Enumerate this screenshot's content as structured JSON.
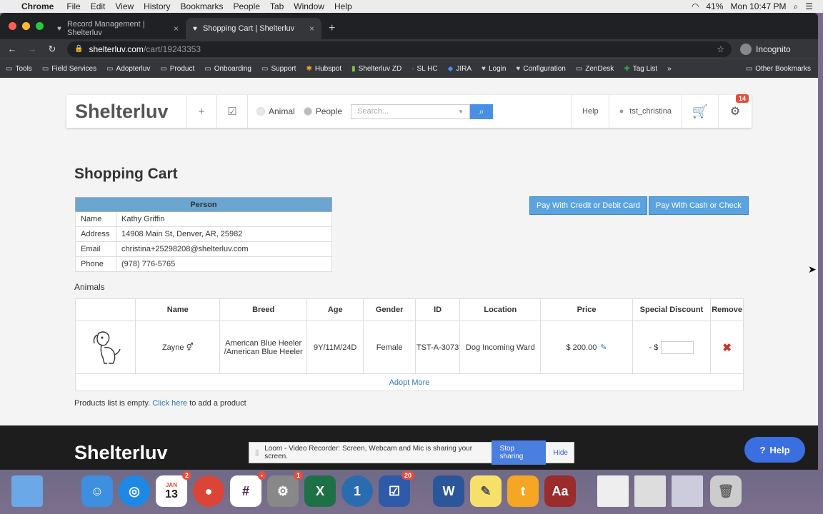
{
  "menubar": {
    "items": [
      "Chrome",
      "File",
      "Edit",
      "View",
      "History",
      "Bookmarks",
      "People",
      "Tab",
      "Window",
      "Help"
    ],
    "battery": "41%",
    "clock": "Mon 10:47 PM"
  },
  "browser": {
    "tabs": [
      {
        "title": "Record Management | Shelterluv"
      },
      {
        "title": "Shopping Cart | Shelterluv"
      }
    ],
    "url_host": "shelterluv.com",
    "url_path": "/cart/19243353",
    "incognito_label": "Incognito",
    "bookmarks": [
      "Tools",
      "Field Services",
      "Adopterluv",
      "Product",
      "Onboarding",
      "Support",
      "Hubspot",
      "Shelterluv ZD",
      "SL HC",
      "JIRA",
      "Login",
      "Configuration",
      "ZenDesk",
      "Tag List"
    ],
    "bookmarks_more": "»",
    "other_bookmarks": "Other Bookmarks"
  },
  "topbar": {
    "logo": "Shelterluv",
    "radio_animal": "Animal",
    "radio_people": "People",
    "search_placeholder": "Search...",
    "help": "Help",
    "user": "tst_christina",
    "badge": "14"
  },
  "page": {
    "title": "Shopping Cart",
    "pay_card": "Pay With Credit or Debit Card",
    "pay_cash": "Pay With Cash or Check"
  },
  "person": {
    "header": "Person",
    "rows": [
      {
        "label": "Name",
        "value": "Kathy Griffin"
      },
      {
        "label": "Address",
        "value": "14908 Main St, Denver, AR, 25982"
      },
      {
        "label": "Email",
        "value": "christina+25298208@shelterluv.com"
      },
      {
        "label": "Phone",
        "value": "(978) 776-5765"
      }
    ]
  },
  "animals": {
    "label": "Animals",
    "columns": [
      "Name",
      "Breed",
      "Age",
      "Gender",
      "ID",
      "Location",
      "Price",
      "Special Discount",
      "Remove"
    ],
    "rows": [
      {
        "name": "Zayne",
        "gender_symbol": "⚥",
        "breed": "American Blue Heeler /American Blue Heeler",
        "age": "9Y/11M/24D",
        "gender": "Female",
        "id": "TST-A-3073",
        "location": "Dog Incoming Ward",
        "price": "$ 200.00",
        "discount_prefix": "- $"
      }
    ],
    "adopt_more": "Adopt More"
  },
  "products": {
    "text": "Products list is empty.",
    "link": "Click here",
    "suffix": "to add a product"
  },
  "footer": {
    "logo": "Shelterluv"
  },
  "loom": {
    "text": "Loom - Video Recorder: Screen, Webcam and Mic is sharing your screen.",
    "stop": "Stop sharing",
    "hide": "Hide"
  },
  "help_widget": {
    "label": "Help"
  },
  "dock": {
    "calendar_month": "JAN",
    "calendar_day": "13",
    "badge_calendar": "2",
    "badge_slack": "•",
    "badge_prefs": "1",
    "badge_tasks": "20"
  }
}
